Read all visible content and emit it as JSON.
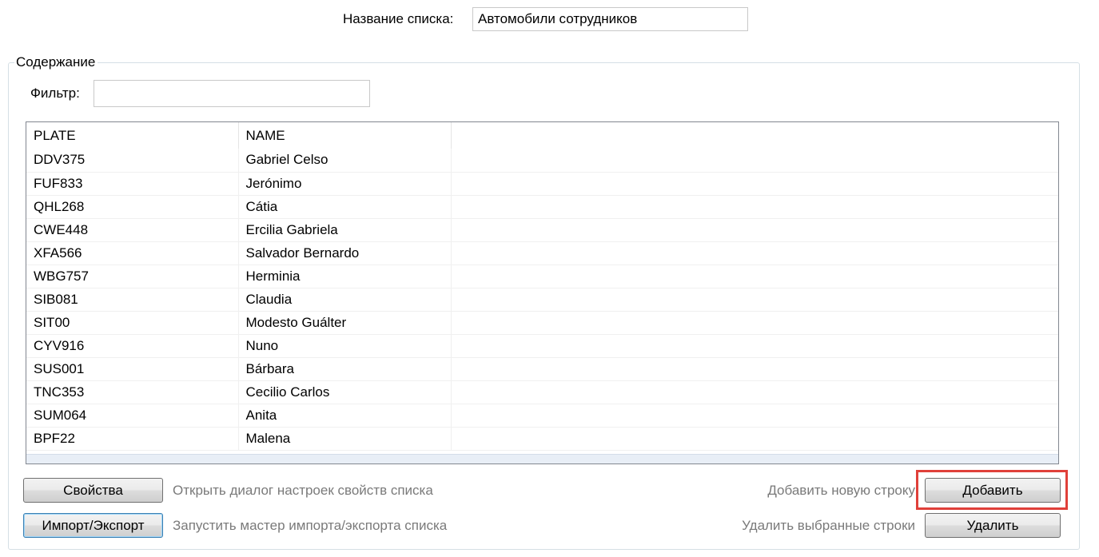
{
  "list_name": {
    "label": "Название списка:",
    "value": "Автомобили сотрудников"
  },
  "content_group": {
    "title": "Содержание"
  },
  "filter": {
    "label": "Фильтр:",
    "value": ""
  },
  "table": {
    "columns": [
      "PLATE",
      "NAME"
    ],
    "rows": [
      [
        "DDV375",
        "Gabriel Celso"
      ],
      [
        "FUF833",
        "Jerónimo"
      ],
      [
        "QHL268",
        "Cátia"
      ],
      [
        "CWE448",
        "Ercilia Gabriela"
      ],
      [
        "XFA566",
        "Salvador Bernardo"
      ],
      [
        "WBG757",
        "Herminia"
      ],
      [
        "SIB081",
        "Claudia"
      ],
      [
        "SIT00",
        "Modesto Guálter"
      ],
      [
        "CYV916",
        "Nuno"
      ],
      [
        "SUS001",
        "Bárbara"
      ],
      [
        "TNC353",
        "Cecilio Carlos"
      ],
      [
        "SUM064",
        "Anita"
      ],
      [
        "BPF22",
        "Malena"
      ]
    ]
  },
  "buttons": {
    "properties": {
      "label": "Свойства",
      "hint": "Открыть диалог настроек свойств списка"
    },
    "import_export": {
      "label": "Импорт/Экспорт",
      "hint": "Запустить мастер импорта/экспорта списка"
    },
    "add": {
      "label": "Добавить",
      "hint": "Добавить новую строку"
    },
    "delete": {
      "label": "Удалить",
      "hint": "Удалить выбранные строки"
    }
  },
  "colors": {
    "highlight": "#e0403a",
    "focus_border": "#3c7fb1"
  }
}
